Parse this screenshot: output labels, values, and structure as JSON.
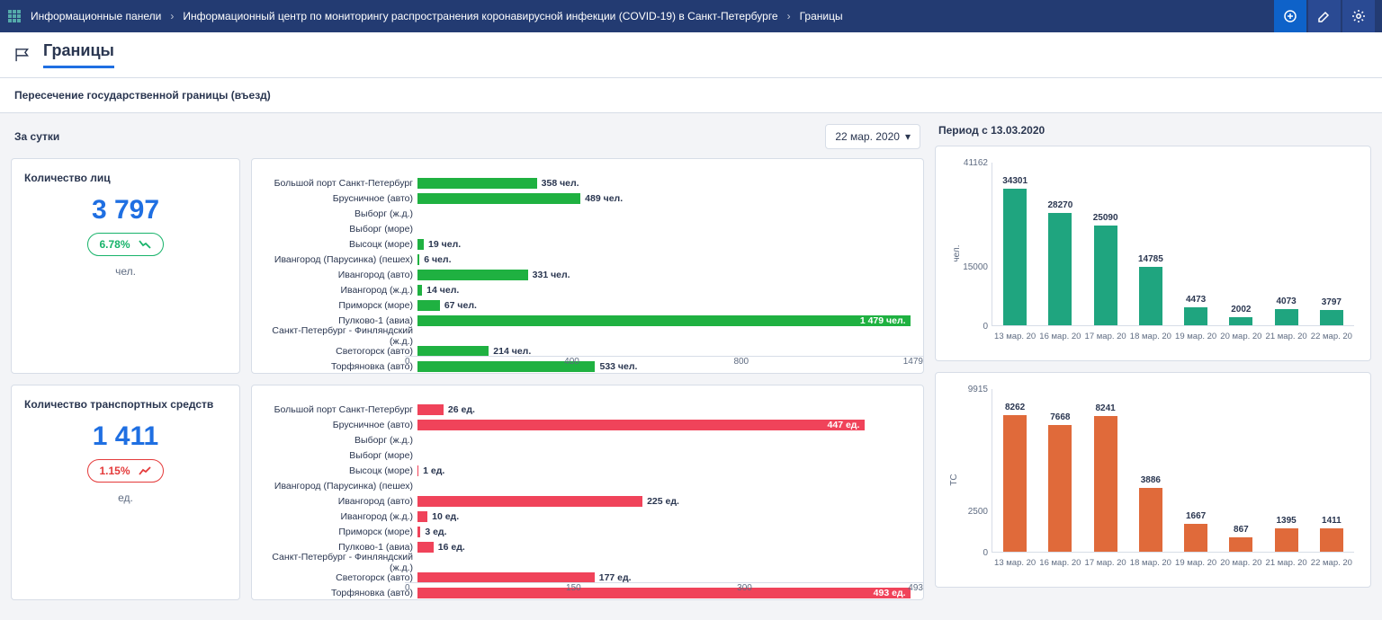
{
  "breadcrumbs": {
    "root": "Информационные панели",
    "mid": "Информационный центр по мониторингу распространения коронавирусной инфекции (COVID-19) в Санкт-Петербурге",
    "leaf": "Границы"
  },
  "page_title": "Границы",
  "section_title": "Пересечение государственной границы (въезд)",
  "per_day_label": "За сутки",
  "period_label": "Период с 13.03.2020",
  "date_picker": "22 мар. 2020",
  "kpi_persons": {
    "title": "Количество лиц",
    "value": "3 797",
    "delta": "6.78%",
    "trend": "down",
    "unit": "чел."
  },
  "kpi_vehicles": {
    "title": "Количество транспортных средств",
    "value": "1 411",
    "delta": "1.15%",
    "trend": "up",
    "unit": "ед."
  },
  "chart_data": [
    {
      "id": "persons_bar",
      "type": "bar_horizontal",
      "unit_suffix": "чел.",
      "xlim": [
        0,
        1479
      ],
      "xticks": [
        0,
        400,
        800,
        1479
      ],
      "color": "green",
      "items": [
        {
          "label": "Большой порт Санкт-Петербург",
          "value": 358
        },
        {
          "label": "Брусничное (авто)",
          "value": 489
        },
        {
          "label": "Выборг (ж.д.)",
          "value": 0
        },
        {
          "label": "Выборг (море)",
          "value": 0
        },
        {
          "label": "Высоцк (море)",
          "value": 19
        },
        {
          "label": "Ивангород (Парусинка) (пешех)",
          "value": 6
        },
        {
          "label": "Ивангород (авто)",
          "value": 331
        },
        {
          "label": "Ивангород (ж.д.)",
          "value": 14
        },
        {
          "label": "Приморск (море)",
          "value": 67
        },
        {
          "label": "Пулково-1 (авиа)",
          "value": 1479,
          "value_display": "1 479"
        },
        {
          "label": "Санкт-Петербург - Финляндский (ж.д.)",
          "value": 0
        },
        {
          "label": "Светогорск (авто)",
          "value": 214
        },
        {
          "label": "Торфяновка (авто)",
          "value": 533
        }
      ]
    },
    {
      "id": "vehicles_bar",
      "type": "bar_horizontal",
      "unit_suffix": "ед.",
      "xlim": [
        0,
        493
      ],
      "xticks": [
        0,
        150,
        300,
        493
      ],
      "color": "red",
      "items": [
        {
          "label": "Большой порт Санкт-Петербург",
          "value": 26
        },
        {
          "label": "Брусничное (авто)",
          "value": 447
        },
        {
          "label": "Выборг (ж.д.)",
          "value": 0
        },
        {
          "label": "Выборг (море)",
          "value": 0
        },
        {
          "label": "Высоцк (море)",
          "value": 1
        },
        {
          "label": "Ивангород (Парусинка) (пешех)",
          "value": 0
        },
        {
          "label": "Ивангород (авто)",
          "value": 225
        },
        {
          "label": "Ивангород (ж.д.)",
          "value": 10
        },
        {
          "label": "Приморск (море)",
          "value": 3
        },
        {
          "label": "Пулково-1 (авиа)",
          "value": 16
        },
        {
          "label": "Санкт-Петербург - Финляндский (ж.д.)",
          "value": 0
        },
        {
          "label": "Светогорск (авто)",
          "value": 177
        },
        {
          "label": "Торфяновка (авто)",
          "value": 493
        }
      ]
    },
    {
      "id": "persons_period",
      "type": "bar_vertical",
      "ylabel": "чел.",
      "ylim": [
        0,
        41162
      ],
      "yticks": [
        0,
        15000,
        41162
      ],
      "color": "green2",
      "categories": [
        "13 мар. 20",
        "16 мар. 20",
        "17 мар. 20",
        "18 мар. 20",
        "19 мар. 20",
        "20 мар. 20",
        "21 мар. 20",
        "22 мар. 20"
      ],
      "values": [
        34301,
        28270,
        25090,
        14785,
        4473,
        2002,
        4073,
        3797
      ]
    },
    {
      "id": "vehicles_period",
      "type": "bar_vertical",
      "ylabel": "ТС",
      "ylim": [
        0,
        9915
      ],
      "yticks": [
        0,
        2500,
        9915
      ],
      "color": "orange",
      "categories": [
        "13 мар. 20",
        "16 мар. 20",
        "17 мар. 20",
        "18 мар. 20",
        "19 мар. 20",
        "20 мар. 20",
        "21 мар. 20",
        "22 мар. 20"
      ],
      "values": [
        8262,
        7668,
        8241,
        3886,
        1667,
        867,
        1395,
        1411
      ]
    }
  ]
}
